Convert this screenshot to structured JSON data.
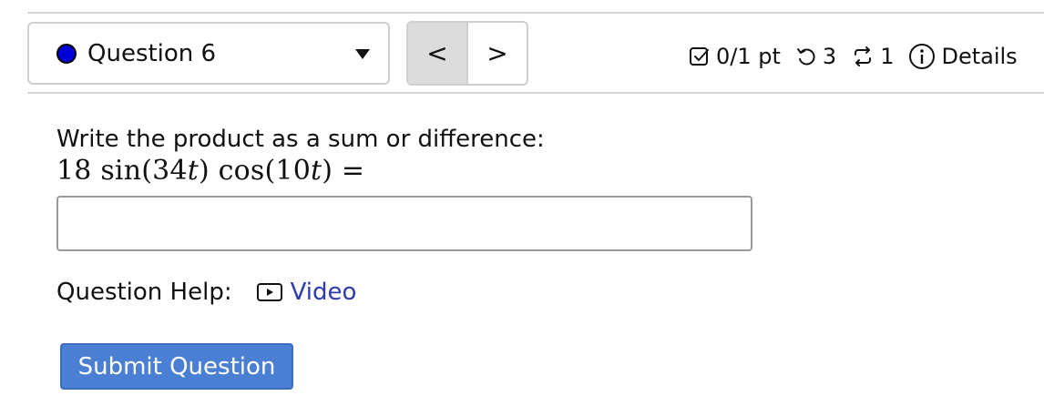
{
  "header": {
    "question_selector": {
      "label": "Question 6",
      "dot_color": "#0000d8"
    },
    "nav": {
      "prev_label": "<",
      "next_label": ">"
    },
    "status": {
      "points": "0/1 pt",
      "attempts_left": "3",
      "retries": "1",
      "details_label": "Details"
    }
  },
  "question": {
    "prompt": "Write the product as a sum or difference:",
    "expression": {
      "coef": "18",
      "f1": "sin",
      "arg1": "34",
      "f2": "cos",
      "arg2": "10",
      "var": "t",
      "equals": "="
    },
    "answer_value": ""
  },
  "help": {
    "label": "Question Help:",
    "video_label": "Video",
    "link_color": "#2f3ab2"
  },
  "submit": {
    "label": "Submit Question",
    "color": "#4a7fd4"
  }
}
